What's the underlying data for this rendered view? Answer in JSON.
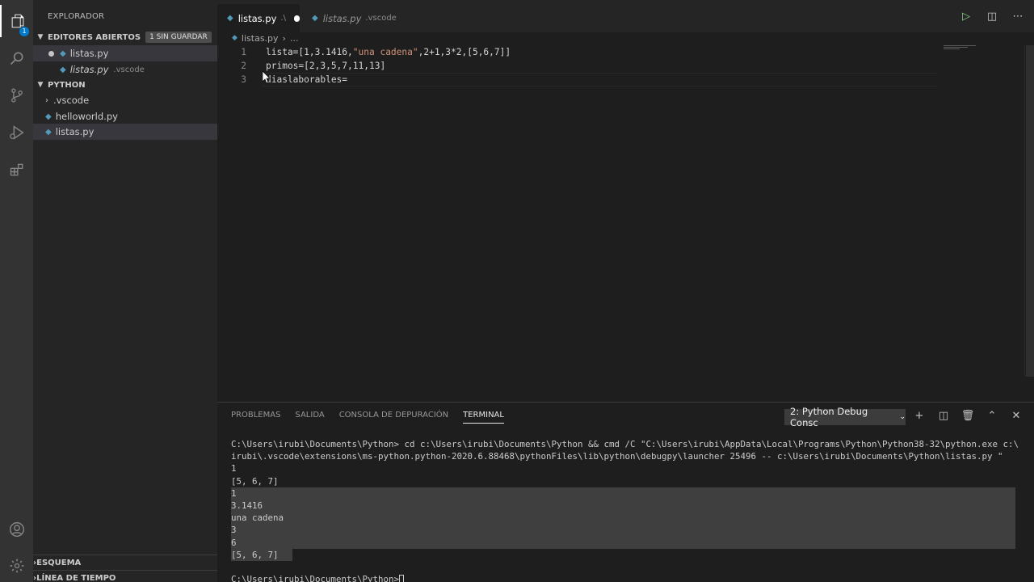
{
  "sidebar": {
    "title": "EXPLORADOR",
    "open_editors": {
      "label": "EDITORES ABIERTOS",
      "unsaved": "1 SIN GUARDAR",
      "items": [
        {
          "name": "listas.py",
          "suffix": ""
        },
        {
          "name": "listas.py",
          "suffix": ".vscode"
        }
      ]
    },
    "folder": {
      "label": "PYTHON",
      "items": [
        {
          "name": ".vscode"
        },
        {
          "name": "helloworld.py"
        },
        {
          "name": "listas.py"
        }
      ]
    },
    "outline": "ESQUEMA",
    "timeline": "LÍNEA DE TIEMPO",
    "explorer_badge": "1"
  },
  "tabs": [
    {
      "label": "listas.py",
      "suffix": ".\\"
    },
    {
      "label": "listas.py",
      "suffix": ".vscode"
    }
  ],
  "breadcrumb": {
    "file": "listas.py",
    "more": "..."
  },
  "editor": {
    "lines": [
      {
        "num": "1",
        "pre": "lista=[1,3.1416,",
        "str": "\"una cadena\"",
        "post": ",2+1,3*2,[5,6,7]]"
      },
      {
        "num": "2",
        "pre": "primos=[2,3,5,7,11,13]",
        "str": "",
        "post": ""
      },
      {
        "num": "3",
        "pre": "diaslaborables=",
        "str": "",
        "post": ""
      }
    ]
  },
  "panel": {
    "tabs": [
      "PROBLEMAS",
      "SALIDA",
      "CONSOLA DE DEPURACIÓN",
      "TERMINAL"
    ],
    "terminal_select": "2: Python Debug Consc",
    "terminal_lines": [
      "C:\\Users\\irubi\\Documents\\Python> cd c:\\Users\\irubi\\Documents\\Python && cmd /C \"C:\\Users\\irubi\\AppData\\Local\\Programs\\Python\\Python38-32\\python.exe c:\\Users\\",
      "irubi\\.vscode\\extensions\\ms-python.python-2020.6.88468\\pythonFiles\\lib\\python\\debugpy\\launcher 25496 -- c:\\Users\\irubi\\Documents\\Python\\listas.py \"",
      "1",
      "[5, 6, 7]",
      "1",
      "3.1416",
      "una cadena",
      "3",
      "6",
      "[5, 6, 7]",
      "",
      "C:\\Users\\irubi\\Documents\\Python>"
    ]
  }
}
